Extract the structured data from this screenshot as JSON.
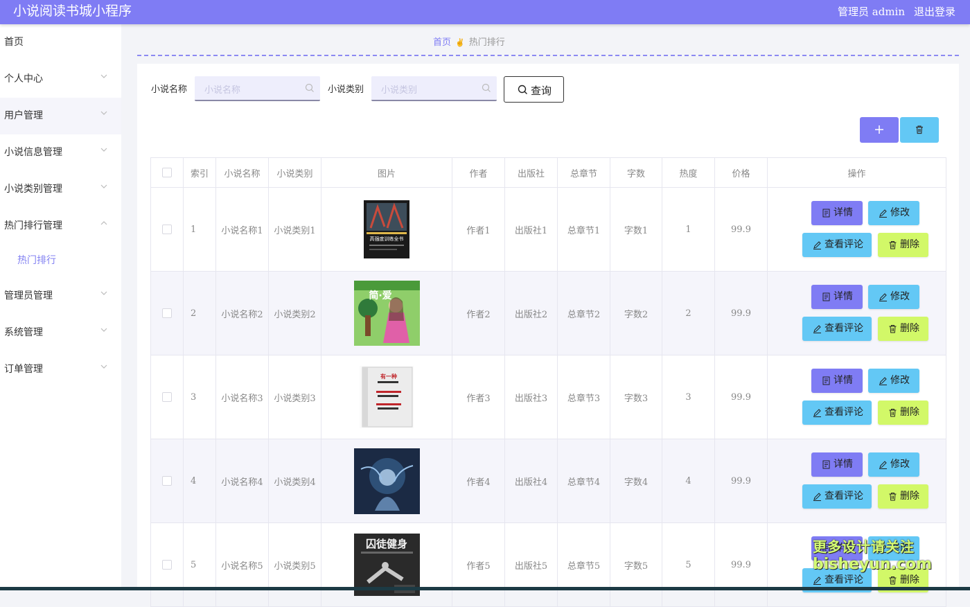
{
  "header": {
    "title": "小说阅读书城小程序",
    "admin": "管理员 admin",
    "logout": "退出登录"
  },
  "sidebar": {
    "items": [
      {
        "label": "首页",
        "has_chevron": false
      },
      {
        "label": "个人中心",
        "has_chevron": true
      },
      {
        "label": "用户管理",
        "has_chevron": true
      },
      {
        "label": "小说信息管理",
        "has_chevron": true
      },
      {
        "label": "小说类别管理",
        "has_chevron": true
      },
      {
        "label": "热门排行管理",
        "has_chevron": true,
        "expanded": true
      },
      {
        "label": "管理员管理",
        "has_chevron": true
      },
      {
        "label": "系统管理",
        "has_chevron": true
      },
      {
        "label": "订单管理",
        "has_chevron": true
      }
    ],
    "subitem": "热门排行"
  },
  "breadcrumb": {
    "home": "首页",
    "current": "热门排行"
  },
  "search": {
    "name_label": "小说名称",
    "name_placeholder": "小说名称",
    "type_label": "小说类别",
    "type_placeholder": "小说类别",
    "query_label": "查询"
  },
  "table": {
    "headers": [
      "索引",
      "小说名称",
      "小说类别",
      "图片",
      "作者",
      "出版社",
      "总章节",
      "字数",
      "热度",
      "价格",
      "操作"
    ],
    "ops": {
      "detail": "详情",
      "edit": "修改",
      "comments": "查看评论",
      "delete": "删除"
    },
    "rows": [
      {
        "index": "1",
        "name": "小说名称1",
        "type": "小说类别1",
        "author": "作者1",
        "publisher": "出版社1",
        "chapters": "总章节1",
        "words": "字数1",
        "heat": "1",
        "price": "99.9",
        "cover_text": "高强度训练全书"
      },
      {
        "index": "2",
        "name": "小说名称2",
        "type": "小说类别2",
        "author": "作者2",
        "publisher": "出版社2",
        "chapters": "总章节2",
        "words": "字数2",
        "heat": "2",
        "price": "99.9",
        "cover_text": "简·爱"
      },
      {
        "index": "3",
        "name": "小说名称3",
        "type": "小说类别3",
        "author": "作者3",
        "publisher": "出版社3",
        "chapters": "总章节3",
        "words": "字数3",
        "heat": "3",
        "price": "99.9",
        "cover_text": "有一种"
      },
      {
        "index": "4",
        "name": "小说名称4",
        "type": "小说类别4",
        "author": "作者4",
        "publisher": "出版社4",
        "chapters": "总章节4",
        "words": "字数4",
        "heat": "4",
        "price": "99.9",
        "cover_text": ""
      },
      {
        "index": "5",
        "name": "小说名称5",
        "type": "小说类别5",
        "author": "作者5",
        "publisher": "出版社5",
        "chapters": "总章节5",
        "words": "字数5",
        "heat": "5",
        "price": "99.9",
        "cover_text": "囚徒健身"
      }
    ]
  },
  "watermark": {
    "line1": "更多设计请关注",
    "line2": "bisheyun.com"
  },
  "colors": {
    "primary": "#7f7cf4",
    "info": "#63c8f5",
    "lime": "#d2f868"
  }
}
